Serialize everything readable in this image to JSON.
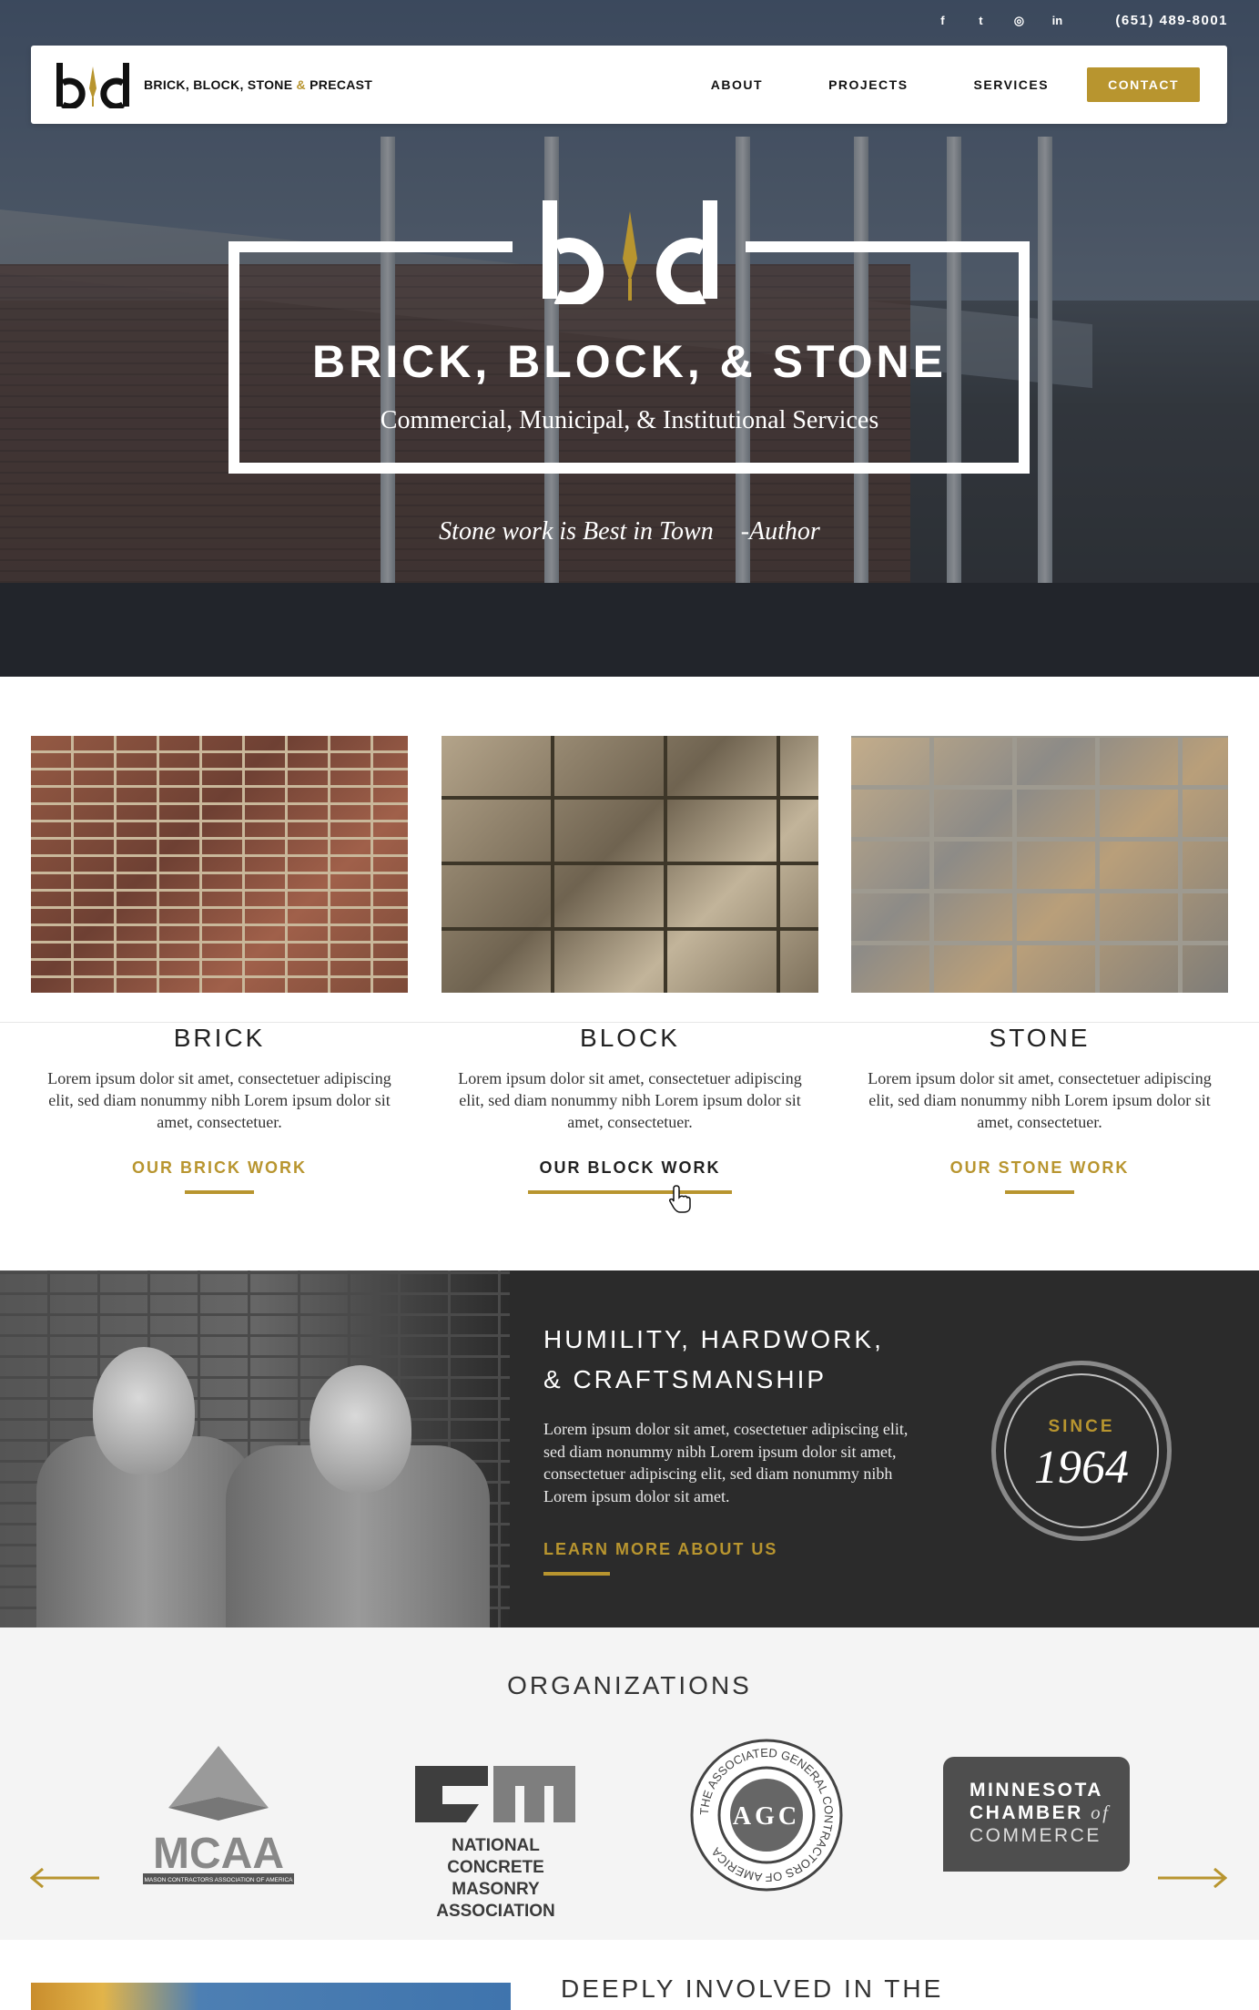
{
  "topbar": {
    "social": [
      "f",
      "t",
      "◎",
      "in"
    ],
    "social_icons": [
      "facebook-icon",
      "twitter-icon",
      "instagram-icon",
      "linkedin-icon"
    ],
    "phone": "(651) 489-8001"
  },
  "brand": {
    "name_part1": "BRICK, BLOCK, STONE ",
    "amp": "&",
    "name_part2": " PRECAST",
    "accent_color": "#b8952f"
  },
  "nav": {
    "about": "ABOUT",
    "projects": "PROJECTS",
    "services": "SERVICES",
    "contact": "CONTACT"
  },
  "hero": {
    "title": "BRICK, BLOCK, & STONE",
    "subtitle": "Commercial, Municipal, & Institutional Services",
    "quote": "Stone work is Best in Town",
    "author": "-Author"
  },
  "materials": [
    {
      "title": "BRICK",
      "text": "Lorem ipsum dolor sit amet, consectetuer adipiscing elit, sed diam nonummy nibh Lorem ipsum dolor sit amet, consectetuer.",
      "link": "OUR BRICK WORK"
    },
    {
      "title": "BLOCK",
      "text": "Lorem ipsum dolor sit amet, consectetuer adipiscing elit, sed diam nonummy nibh Lorem ipsum dolor sit amet, consectetuer.",
      "link": "OUR BLOCK WORK"
    },
    {
      "title": "STONE",
      "text": "Lorem ipsum dolor sit amet, consectetuer adipiscing elit, sed diam nonummy nibh Lorem ipsum dolor sit amet, consectetuer.",
      "link": "OUR STONE WORK"
    }
  ],
  "about": {
    "heading_line1": "HUMILITY, HARDWORK,",
    "heading_line2": "& CRAFTSMANSHIP",
    "text": "Lorem ipsum dolor sit amet, cosectetuer adipiscing elit, sed diam nonummy nibh Lorem ipsum dolor sit amet, consectetuer adipiscing elit, sed diam nonummy nibh Lorem ipsum dolor sit amet.",
    "link": "LEARN MORE ABOUT US",
    "since_label": "SINCE",
    "since_year": "1964"
  },
  "organizations": {
    "heading": "ORGANIZATIONS",
    "mcaa": {
      "abbr": "MCAA",
      "full": "MASON CONTRACTORS ASSOCIATION OF AMERICA"
    },
    "ncma": {
      "line1": "NATIONAL CONCRETE",
      "line2": "MASONRY ASSOCIATION"
    },
    "agc": {
      "ring": "THE ASSOCIATED GENERAL CONTRACTORS OF AMERICA",
      "letters": "AGC"
    },
    "mcc": {
      "line1": "MINNESOTA",
      "line2a": "CHAMBER",
      "line2b": "of",
      "line3": "COMMERCE"
    }
  },
  "teaser": {
    "heading": "DEEPLY INVOLVED IN THE"
  }
}
